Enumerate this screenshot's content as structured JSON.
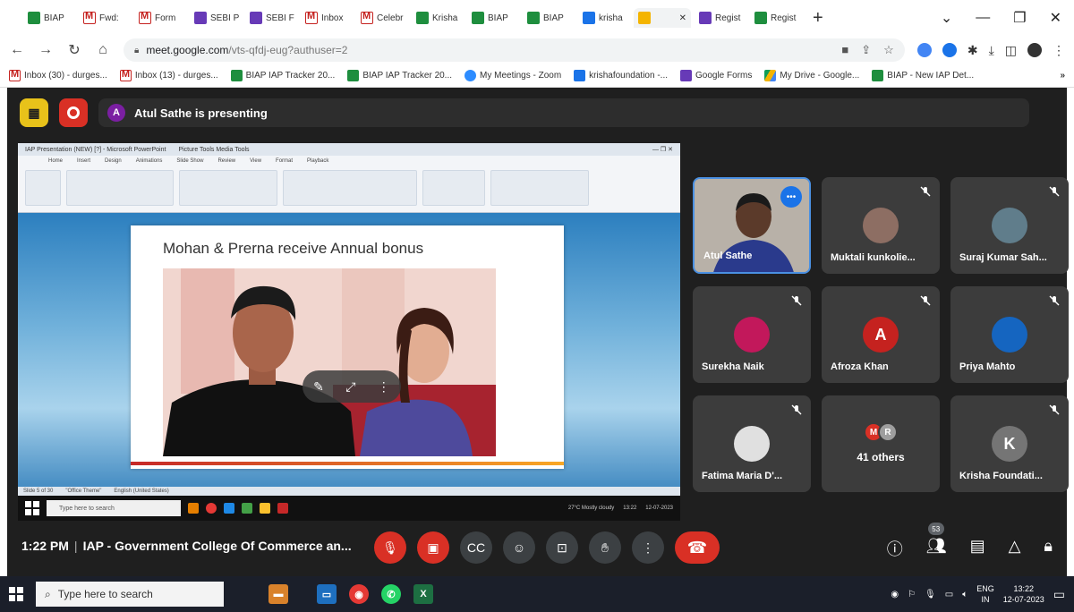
{
  "browser": {
    "tabs": [
      {
        "label": "BIAP",
        "icon": "sheets"
      },
      {
        "label": "Fwd:",
        "icon": "gmail"
      },
      {
        "label": "Form",
        "icon": "gmail"
      },
      {
        "label": "SEBI P",
        "icon": "forms"
      },
      {
        "label": "SEBI F",
        "icon": "forms"
      },
      {
        "label": "Inbox",
        "icon": "gmail"
      },
      {
        "label": "Celebr",
        "icon": "gmail"
      },
      {
        "label": "Krisha",
        "icon": "sheets"
      },
      {
        "label": "BIAP",
        "icon": "sheets"
      },
      {
        "label": "BIAP",
        "icon": "sheets"
      },
      {
        "label": "krisha",
        "icon": "docs"
      },
      {
        "label": "",
        "icon": "slides",
        "active": true
      },
      {
        "label": "Regist",
        "icon": "forms"
      },
      {
        "label": "Regist",
        "icon": "sheets"
      }
    ],
    "address": {
      "host": "meet.google.com",
      "path": "/vts-qfdj-eug?authuser=2"
    },
    "bookmarks": [
      {
        "label": "Inbox (30) - durges...",
        "icon": "gmail"
      },
      {
        "label": "Inbox (13) - durges...",
        "icon": "gmail"
      },
      {
        "label": "BIAP IAP Tracker 20...",
        "icon": "sheets"
      },
      {
        "label": "BIAP IAP Tracker 20...",
        "icon": "sheets"
      },
      {
        "label": "My Meetings - Zoom",
        "icon": "zoom"
      },
      {
        "label": "krishafoundation -...",
        "icon": "docs"
      },
      {
        "label": "Google Forms",
        "icon": "forms"
      },
      {
        "label": "My Drive - Google...",
        "icon": "drive"
      },
      {
        "label": "BIAP - New IAP Det...",
        "icon": "sheets"
      }
    ],
    "bookmarks_more": "»"
  },
  "meet": {
    "presenter_initial": "A",
    "presenting_text": "Atul Sathe is presenting",
    "shared_screen": {
      "window_title": "IAP Presentation (NEW) [?] - Microsoft PowerPoint",
      "ribbon_context": "Picture Tools  Media Tools",
      "ribbon_tabs": [
        "Home",
        "Insert",
        "Design",
        "Animations",
        "Slide Show",
        "Review",
        "View",
        "Format",
        "Playback"
      ],
      "slide_title": "Mohan & Prerna receive Annual bonus",
      "status_items": [
        "Slide 5 of 30",
        "\"Office Theme\"",
        "English (United States)"
      ],
      "inner_search_placeholder": "Type here to search",
      "inner_weather": "27°C  Mostly cloudy",
      "inner_time": "13:22",
      "inner_date": "12-07-2023"
    },
    "participants": [
      {
        "name": "Atul Sathe",
        "type": "video",
        "speaking": true
      },
      {
        "name": "Muktali kunkolie...",
        "type": "photo",
        "color": "#8d6e63"
      },
      {
        "name": "Suraj Kumar Sah...",
        "type": "photo",
        "color": "#607d8b"
      },
      {
        "name": "Surekha Naik",
        "type": "photo",
        "color": "#c2185b"
      },
      {
        "name": "Afroza Khan",
        "type": "initial",
        "initial": "A",
        "color": "#c5221f"
      },
      {
        "name": "Priya Mahto",
        "type": "photo",
        "color": "#1565c0"
      },
      {
        "name": "Fatima Maria D'...",
        "type": "photo",
        "color": "#e0e0e0"
      },
      {
        "name": "Krisha Foundati...",
        "type": "initial",
        "initial": "K",
        "color": "#757575"
      }
    ],
    "others": {
      "initials": [
        "M",
        "R"
      ],
      "colors": [
        "#d93025",
        "#9e9e9e"
      ],
      "label": "41 others"
    },
    "time": "1:22 PM",
    "meeting_title": "IAP - Government College Of Commerce an...",
    "people_count": "53"
  },
  "taskbar": {
    "search_placeholder": "Type here to search",
    "lang_top": "ENG",
    "lang_bottom": "IN",
    "time": "13:22",
    "date": "12-07-2023"
  }
}
